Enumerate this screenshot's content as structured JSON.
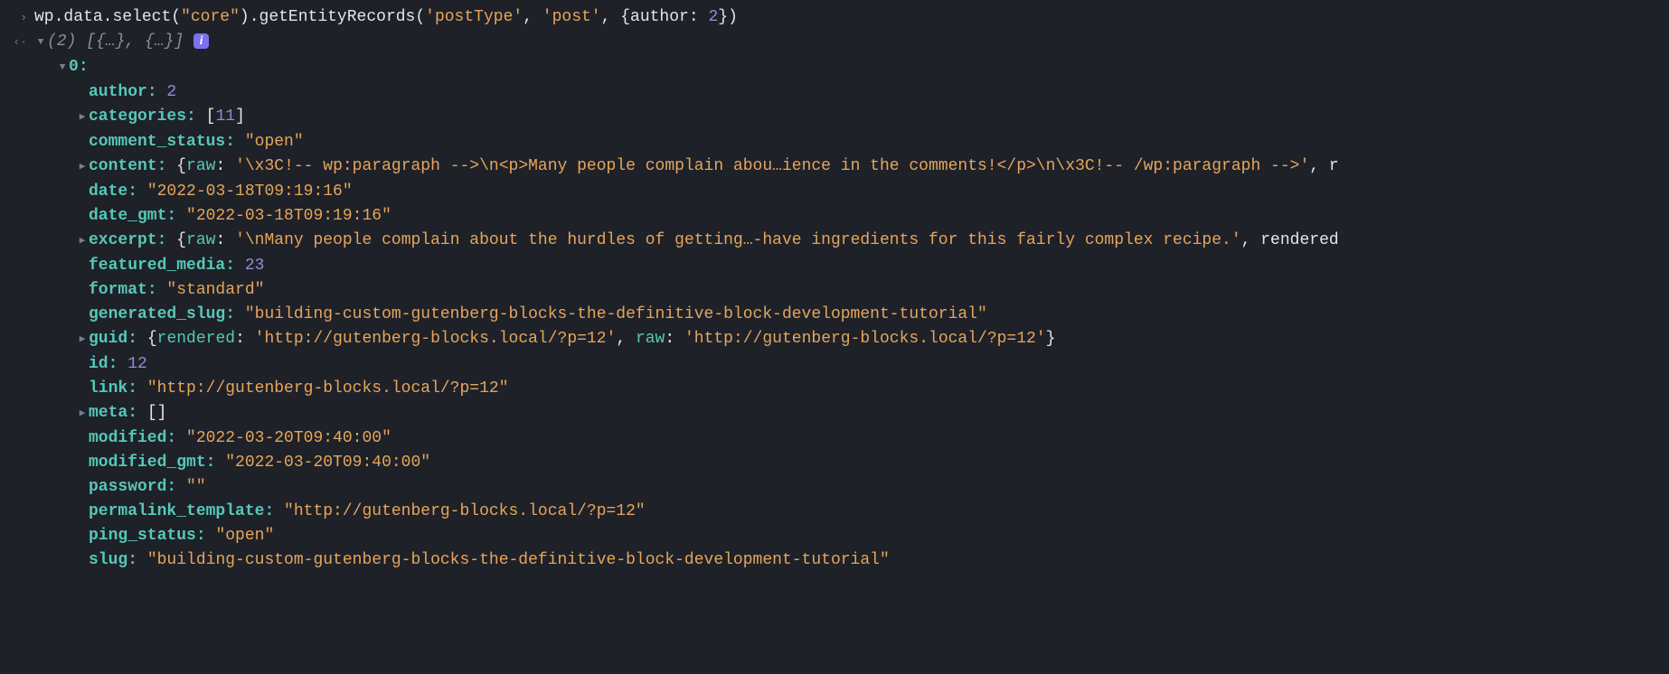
{
  "input_line": {
    "prefix": "wp",
    "dot1": ".",
    "data": "data",
    "dot2": ".",
    "select": "select",
    "p1": "(",
    "arg_core": "\"core\"",
    "p2": ")",
    "dot3": ".",
    "get": "getEntityRecords",
    "p3": "(",
    "arg_pt": "'postType'",
    "comma1": ", ",
    "arg_post": "'post'",
    "comma2": ", ",
    "brace_open": "{",
    "author_key": "author",
    "colon": ": ",
    "author_val": "2",
    "brace_close": "}",
    "p4": ")"
  },
  "result_header": {
    "count": "(2)",
    "summary": " [{…}, {…}] "
  },
  "obj_index": "0",
  "fields": {
    "author": {
      "key": "author",
      "val": "2"
    },
    "categories": {
      "key": "categories",
      "open": "[",
      "val": "11",
      "close": "]"
    },
    "comment_status": {
      "key": "comment_status",
      "val": "\"open\""
    },
    "content": {
      "key": "content",
      "open": "{",
      "raw_key": "raw",
      "raw_val": "'\\x3C!-- wp:paragraph -->\\n<p>Many people complain abou…ience in the comments!</p>\\n\\x3C!-- /wp:paragraph -->'",
      "trail": ", r"
    },
    "date": {
      "key": "date",
      "val": "\"2022-03-18T09:19:16\""
    },
    "date_gmt": {
      "key": "date_gmt",
      "val": "\"2022-03-18T09:19:16\""
    },
    "excerpt": {
      "key": "excerpt",
      "open": "{",
      "raw_key": "raw",
      "raw_val": "'\\nMany people complain about the hurdles of getting…-have ingredients for this fairly complex recipe.'",
      "trail": ", rendered"
    },
    "featured_media": {
      "key": "featured_media",
      "val": "23"
    },
    "format": {
      "key": "format",
      "val": "\"standard\""
    },
    "generated_slug": {
      "key": "generated_slug",
      "val": "\"building-custom-gutenberg-blocks-the-definitive-block-development-tutorial\""
    },
    "guid": {
      "key": "guid",
      "open": "{",
      "rendered_key": "rendered",
      "rendered_val": "'http://gutenberg-blocks.local/?p=12'",
      "comma": ", ",
      "raw_key": "raw",
      "raw_val": "'http://gutenberg-blocks.local/?p=12'",
      "close": "}"
    },
    "id": {
      "key": "id",
      "val": "12"
    },
    "link": {
      "key": "link",
      "val": "\"http://gutenberg-blocks.local/?p=12\""
    },
    "meta": {
      "key": "meta",
      "val": "[]"
    },
    "modified": {
      "key": "modified",
      "val": "\"2022-03-20T09:40:00\""
    },
    "modified_gmt": {
      "key": "modified_gmt",
      "val": "\"2022-03-20T09:40:00\""
    },
    "password": {
      "key": "password",
      "val": "\"\""
    },
    "permalink_template": {
      "key": "permalink_template",
      "val": "\"http://gutenberg-blocks.local/?p=12\""
    },
    "ping_status": {
      "key": "ping_status",
      "val": "\"open\""
    },
    "slug": {
      "key": "slug",
      "val": "\"building-custom-gutenberg-blocks-the-definitive-block-development-tutorial\""
    }
  }
}
